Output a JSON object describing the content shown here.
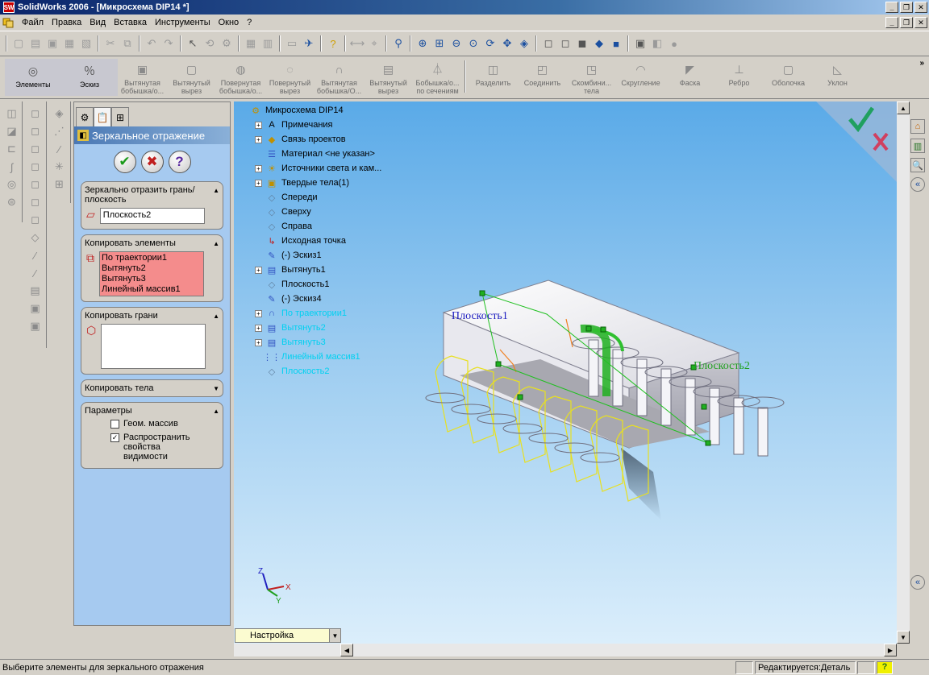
{
  "window": {
    "title": "SolidWorks 2006 - [Микросхема DIP14 *]"
  },
  "menu": {
    "items": [
      "Файл",
      "Правка",
      "Вид",
      "Вставка",
      "Инструменты",
      "Окно",
      "?"
    ]
  },
  "features_toolbar": {
    "items": [
      {
        "label": "Элементы"
      },
      {
        "label": "Эскиз"
      },
      {
        "label": "Вытянутая бобышка/о..."
      },
      {
        "label": "Вытянутый вырез"
      },
      {
        "label": "Повернутая бобышка/о..."
      },
      {
        "label": "Повернутый вырез"
      },
      {
        "label": "Вытянутая бобышка/О..."
      },
      {
        "label": "Вытянутый вырез"
      },
      {
        "label": "Бобышка/о... по сечениям"
      },
      {
        "label": "Разделить"
      },
      {
        "label": "Соединить"
      },
      {
        "label": "Скомбини... тела"
      },
      {
        "label": "Скругление"
      },
      {
        "label": "Фаска"
      },
      {
        "label": "Ребро"
      },
      {
        "label": "Оболочка"
      },
      {
        "label": "Уклон"
      }
    ]
  },
  "property_manager": {
    "title": "Зеркальное отражение",
    "mirror_face": {
      "header": "Зеркально отразить грань/плоскость",
      "value": "Плоскость2"
    },
    "copy_features": {
      "header": "Копировать элементы",
      "items": [
        "По траектории1",
        "Вытянуть2",
        "Вытянуть3",
        "Линейный массив1"
      ]
    },
    "copy_faces": {
      "header": "Копировать грани"
    },
    "copy_bodies": {
      "header": "Копировать тела"
    },
    "options": {
      "header": "Параметры",
      "geom_pattern": "Геом. массив",
      "propagate": "Распространить свойства видимости"
    }
  },
  "feature_tree": {
    "root": "Микросхема DIP14",
    "items": [
      {
        "label": "Примечания",
        "expandable": true,
        "icon": "annotations-icon",
        "color": "#000000"
      },
      {
        "label": "Связь проектов",
        "expandable": true,
        "icon": "design-binder-icon",
        "color": "#000000"
      },
      {
        "label": "Материал <не указан>",
        "expandable": false,
        "icon": "material-icon",
        "color": "#000000"
      },
      {
        "label": "Источники света и кам...",
        "expandable": true,
        "icon": "lights-icon",
        "color": "#000000"
      },
      {
        "label": "Твердые тела(1)",
        "expandable": true,
        "icon": "solid-bodies-icon",
        "color": "#000000"
      },
      {
        "label": "Спереди",
        "expandable": false,
        "icon": "plane-icon",
        "color": "#000000"
      },
      {
        "label": "Сверху",
        "expandable": false,
        "icon": "plane-icon",
        "color": "#000000"
      },
      {
        "label": "Справа",
        "expandable": false,
        "icon": "plane-icon",
        "color": "#000000"
      },
      {
        "label": "Исходная точка",
        "expandable": false,
        "icon": "origin-icon",
        "color": "#000000"
      },
      {
        "label": "(-) Эскиз1",
        "expandable": false,
        "icon": "sketch-icon",
        "color": "#000000"
      },
      {
        "label": "Вытянуть1",
        "expandable": true,
        "icon": "extrude-icon",
        "color": "#000000"
      },
      {
        "label": "Плоскость1",
        "expandable": false,
        "icon": "plane-icon",
        "color": "#000000"
      },
      {
        "label": "(-) Эскиз4",
        "expandable": false,
        "icon": "sketch-icon",
        "color": "#000000"
      },
      {
        "label": "По траектории1",
        "expandable": true,
        "icon": "sweep-icon",
        "color": "#00d0f0"
      },
      {
        "label": "Вытянуть2",
        "expandable": true,
        "icon": "extrude-icon",
        "color": "#00d0f0"
      },
      {
        "label": "Вытянуть3",
        "expandable": true,
        "icon": "extrude-icon",
        "color": "#00d0f0"
      },
      {
        "label": "Линейный массив1",
        "expandable": false,
        "icon": "linear-pattern-icon",
        "color": "#00d0f0"
      },
      {
        "label": "Плоскость2",
        "expandable": false,
        "icon": "plane-icon",
        "color": "#00d0f0"
      }
    ]
  },
  "viewport": {
    "plane1_label": "Плоскость1",
    "plane2_label": "Плоскость2",
    "axis_x": "X",
    "axis_y": "Y",
    "axis_z": "Z"
  },
  "configuration": {
    "tab": "Настройка"
  },
  "status": {
    "message": "Выберите элементы для зеркального отражения",
    "mode": "Редактируется:Деталь"
  }
}
